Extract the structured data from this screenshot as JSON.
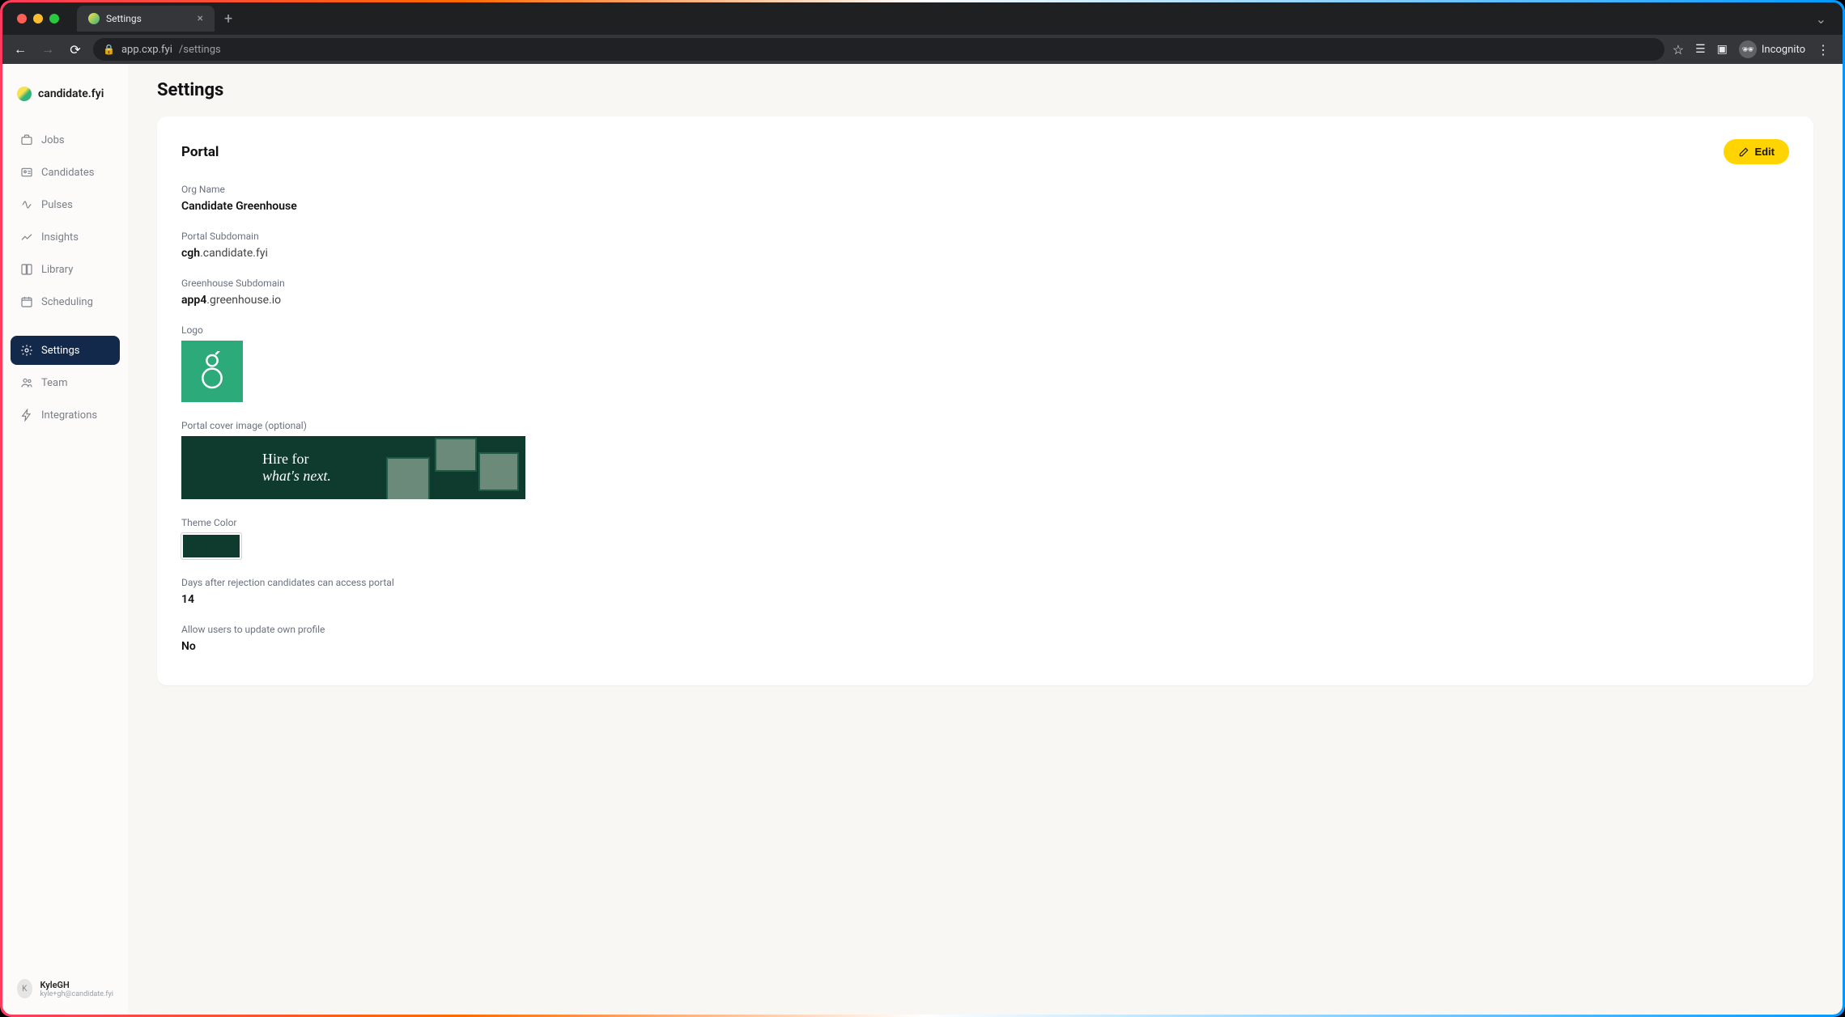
{
  "browser": {
    "tab_title": "Settings",
    "url_host": "app.cxp.fyi",
    "url_path": "/settings",
    "incognito_label": "Incognito"
  },
  "brand": {
    "name": "candidate.fyi"
  },
  "sidebar": {
    "items": [
      {
        "id": "jobs",
        "label": "Jobs"
      },
      {
        "id": "candidates",
        "label": "Candidates"
      },
      {
        "id": "pulses",
        "label": "Pulses"
      },
      {
        "id": "insights",
        "label": "Insights"
      },
      {
        "id": "library",
        "label": "Library"
      },
      {
        "id": "scheduling",
        "label": "Scheduling"
      },
      {
        "id": "settings",
        "label": "Settings",
        "active": true
      },
      {
        "id": "team",
        "label": "Team"
      },
      {
        "id": "integrations",
        "label": "Integrations"
      }
    ]
  },
  "user": {
    "name": "KyleGH",
    "email": "kyle+gh@candidate.fyi",
    "initial": "K"
  },
  "page": {
    "title": "Settings"
  },
  "portal": {
    "section_title": "Portal",
    "edit_label": "Edit",
    "org_name_label": "Org Name",
    "org_name": "Candidate Greenhouse",
    "portal_subdomain_label": "Portal Subdomain",
    "portal_subdomain_value": "cgh",
    "portal_subdomain_suffix": ".candidate.fyi",
    "greenhouse_subdomain_label": "Greenhouse Subdomain",
    "greenhouse_subdomain_value": "app4",
    "greenhouse_subdomain_suffix": ".greenhouse.io",
    "logo_label": "Logo",
    "cover_label": "Portal cover image (optional)",
    "cover_text_line1": "Hire for",
    "cover_text_line2": "what's next.",
    "theme_label": "Theme Color",
    "theme_color": "#0f3b2e",
    "days_label": "Days after rejection candidates can access portal",
    "days_value": "14",
    "allow_update_label": "Allow users to update own profile",
    "allow_update_value": "No"
  }
}
